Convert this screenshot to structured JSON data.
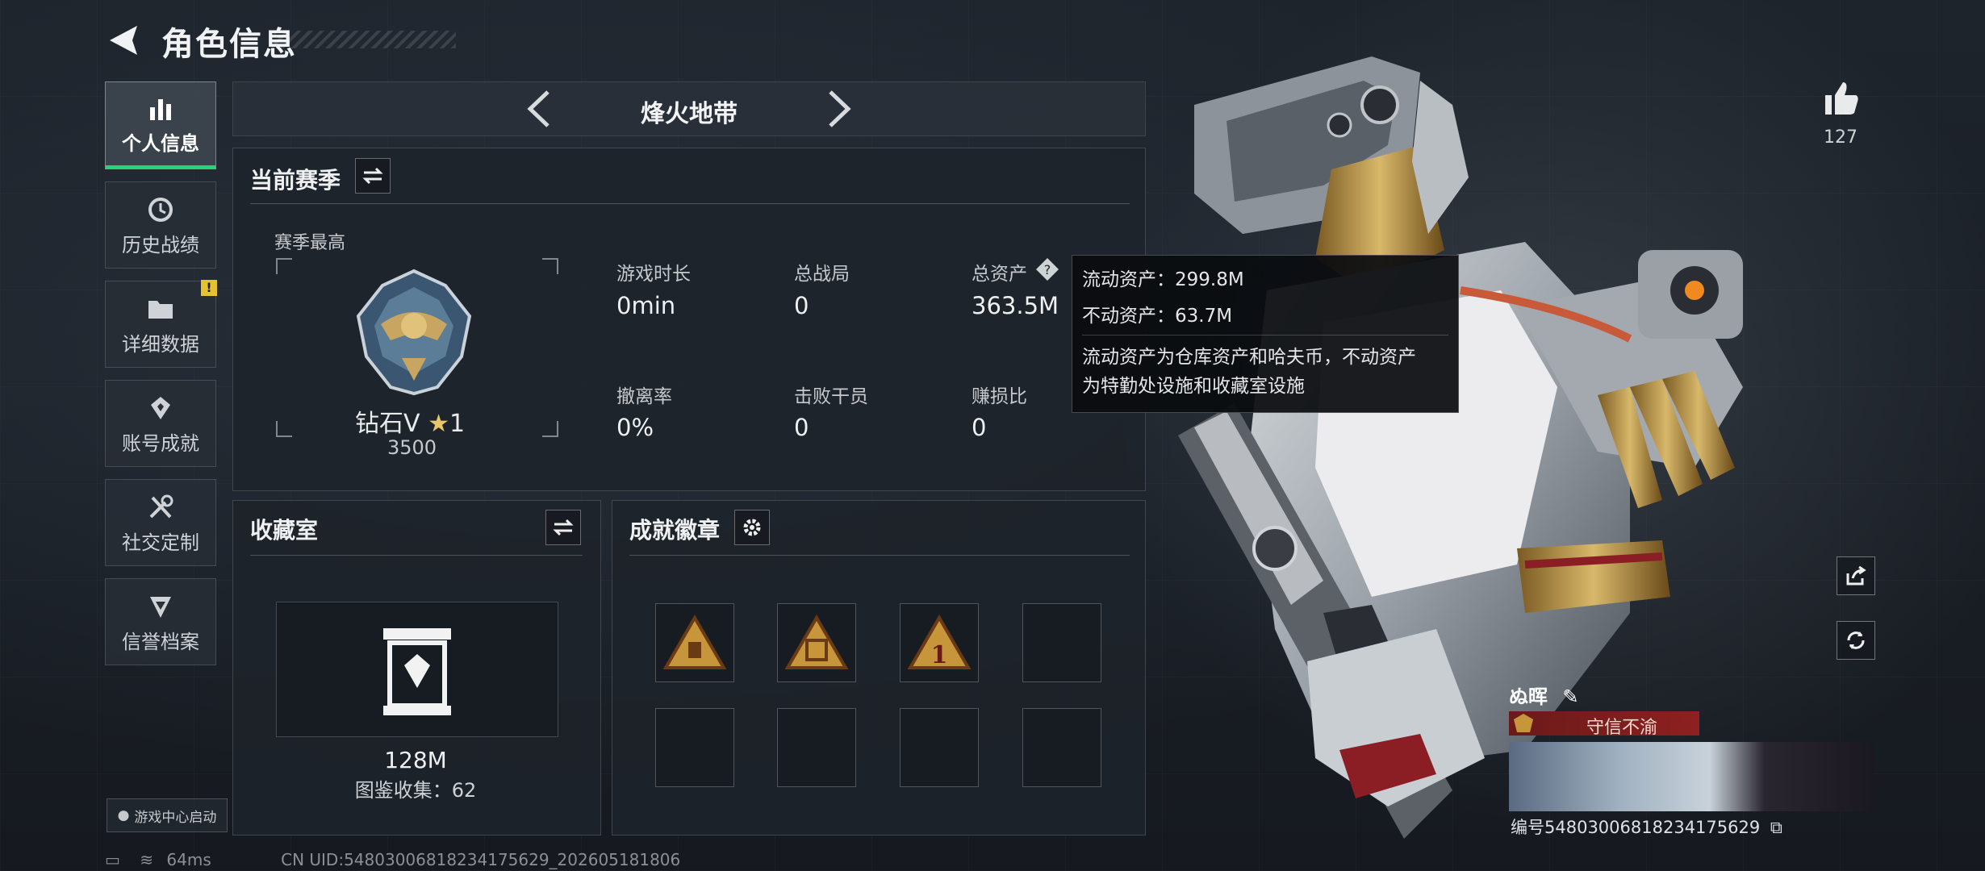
{
  "header": {
    "title": "角色信息"
  },
  "sidebar": {
    "items": [
      {
        "label": "个人信息",
        "icon": "bar-chart-icon"
      },
      {
        "label": "历史战绩",
        "icon": "history-icon"
      },
      {
        "label": "详细数据",
        "icon": "folder-icon",
        "badge": "!"
      },
      {
        "label": "账号成就",
        "icon": "achievement-icon"
      },
      {
        "label": "社交定制",
        "icon": "tools-icon"
      },
      {
        "label": "信誉档案",
        "icon": "credit-icon"
      }
    ],
    "launch_label": "游戏中心启动"
  },
  "mode_bar": {
    "title": "烽火地带"
  },
  "season": {
    "title": "当前赛季",
    "best_label": "赛季最高",
    "rank_name": "钻石V",
    "rank_stars": "1",
    "rank_score": "3500",
    "stats": [
      {
        "label": "游戏时长",
        "value": "0min"
      },
      {
        "label": "总战局",
        "value": "0"
      },
      {
        "label": "总资产",
        "value": "363.5M"
      },
      {
        "label": "撤离率",
        "value": "0%"
      },
      {
        "label": "击败干员",
        "value": "0"
      },
      {
        "label": "赚损比",
        "value": "0"
      }
    ]
  },
  "tooltip": {
    "line1": "流动资产：299.8M",
    "line2": "不动资产：63.7M",
    "desc1": "流动资产为仓库资产和哈夫币，不动资产",
    "desc2": "为特勤处设施和收藏室设施"
  },
  "vault": {
    "title": "收藏室",
    "value": "128M",
    "collection": "图鉴收集：62"
  },
  "badges": {
    "title": "成就徽章",
    "slots": [
      {
        "icon": "badge-triangle-bag-icon",
        "filled": true
      },
      {
        "icon": "badge-triangle-box-icon",
        "filled": true
      },
      {
        "icon": "badge-triangle-one-icon",
        "filled": true
      },
      {
        "icon": "",
        "filled": false
      },
      {
        "icon": "",
        "filled": false
      },
      {
        "icon": "",
        "filled": false
      },
      {
        "icon": "",
        "filled": false
      },
      {
        "icon": "",
        "filled": false
      }
    ]
  },
  "right": {
    "likes": "127",
    "player_name": "ぬ晖",
    "player_title": "守信不渝",
    "player_id": "编号5480300681823​4175629"
  },
  "status": {
    "ping": "64ms",
    "uid": "CN UID:54803006818234175629_202605181806"
  },
  "colors": {
    "accent": "#2bd07e",
    "warning": "#e6c233",
    "title_tag": "#8e2020"
  }
}
